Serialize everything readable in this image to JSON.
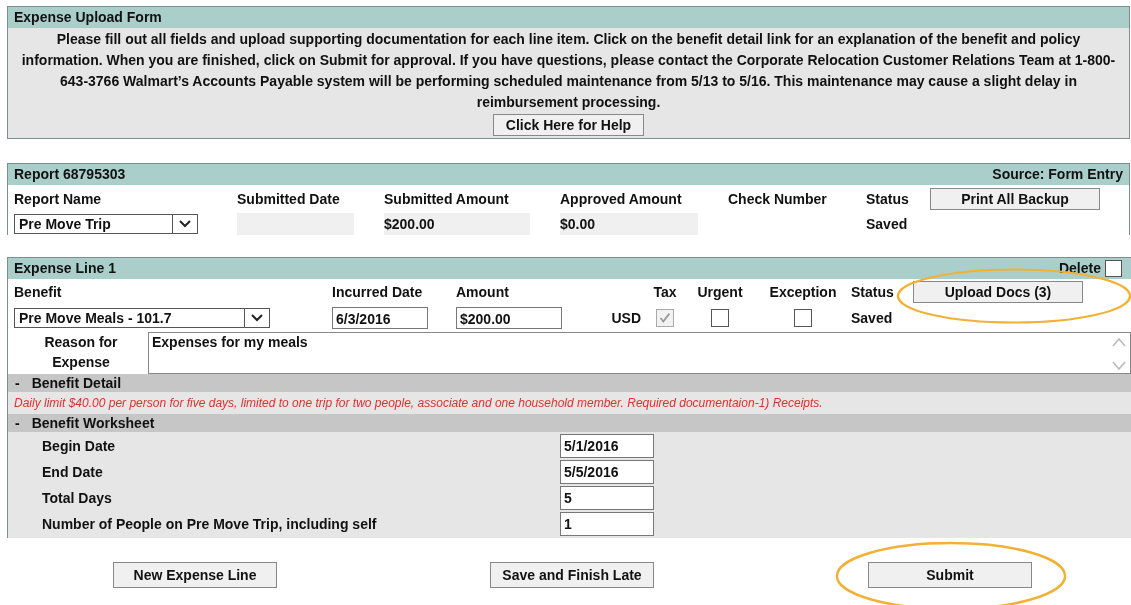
{
  "form": {
    "title": "Expense Upload Form",
    "instructions": "Please fill out all fields and upload supporting documentation for each line item. Click on the benefit detail link for an explanation of the benefit and policy information. When you are finished, click on Submit for approval. If you have questions, please contact the Corporate Relocation Customer Relations Team at 1-800-643-3766 Walmart’s Accounts Payable system will be performing scheduled maintenance from 5/13 to 5/16. This maintenance may cause a slight delay in reimbursement processing.",
    "help_button": "Click Here for Help"
  },
  "report": {
    "title": "Report 68795303",
    "source": "Source: Form Entry",
    "columns": [
      "Report Name",
      "Submitted Date",
      "Submitted Amount",
      "Approved Amount",
      "Check Number",
      "Status"
    ],
    "report_name": "Pre Move Trip",
    "submitted_amount": "$200.00",
    "approved_amount": "$0.00",
    "status": "Saved",
    "print_button": "Print All Backup"
  },
  "expense_line": {
    "title": "Expense Line 1",
    "delete_label": "Delete",
    "delete_checked": false,
    "columns": [
      "Benefit",
      "Incurred Date",
      "Amount",
      "Tax",
      "Urgent",
      "Exception",
      "Status"
    ],
    "benefit": "Pre Move Meals - 101.7",
    "incurred_date": "6/3/2016",
    "amount": "$200.00",
    "currency": "USD",
    "tax": {
      "checked": true,
      "disabled": true
    },
    "urgent": {
      "checked": false,
      "disabled": false
    },
    "exception": {
      "checked": false,
      "disabled": false
    },
    "status": "Saved",
    "upload_button": {
      "label": "Upload Docs (3)",
      "circled": true
    },
    "reason_label": "Reason for Expense",
    "reason": "Expenses for my meals",
    "benefit_detail": {
      "toggle": "-",
      "title": "Benefit Detail",
      "text": "Daily limit $40.00 per person for five days, limited to one trip for two people, associate and one household member. Required documentaion-1) Receipts."
    },
    "worksheet": {
      "toggle": "-",
      "title": "Benefit Worksheet",
      "rows": [
        {
          "label": "Begin Date",
          "value": "5/1/2016"
        },
        {
          "label": "End Date",
          "value": "5/5/2016"
        },
        {
          "label": "Total Days",
          "value": "5"
        },
        {
          "label": "Number of People on Pre Move Trip, including self",
          "value": "1"
        }
      ]
    }
  },
  "buttons": [
    {
      "label": "New Expense Line",
      "circled": false
    },
    {
      "label": "Save and Finish Late",
      "circled": false
    },
    {
      "label": "Submit",
      "circled": true
    }
  ]
}
